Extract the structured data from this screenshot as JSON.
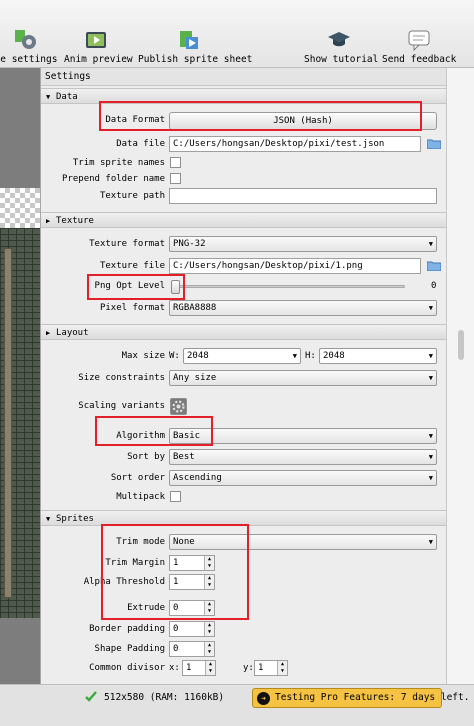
{
  "toolbar": {
    "items": [
      {
        "label": "le settings",
        "icon": "gear-icon"
      },
      {
        "label": "Anim preview",
        "icon": "film-icon"
      },
      {
        "label": "Publish sprite sheet",
        "icon": "publish-icon"
      },
      {
        "label": "Show tutorial",
        "icon": "graduation-cap-icon"
      },
      {
        "label": "Send feedback",
        "icon": "speech-bubble-icon"
      }
    ]
  },
  "panel": {
    "title": "Settings",
    "data": {
      "header": "Data",
      "data_format_label": "Data Format",
      "data_format_value": "JSON (Hash)",
      "data_file_label": "Data file",
      "data_file_value": "C:/Users/hongsan/Desktop/pixi/test.json",
      "trim_sprite_names_label": "Trim sprite names",
      "prepend_folder_name_label": "Prepend folder name",
      "texture_path_label": "Texture path",
      "texture_path_value": ""
    },
    "texture": {
      "header": "Texture",
      "texture_format_label": "Texture format",
      "texture_format_value": "PNG-32",
      "texture_file_label": "Texture file",
      "texture_file_value": "C:/Users/hongsan/Desktop/pixi/1.png",
      "png_opt_level_label": "Png Opt Level",
      "png_opt_level_value": "0",
      "png_opt_level_fraction": 0,
      "pixel_format_label": "Pixel format",
      "pixel_format_value": "RGBA8888"
    },
    "layout": {
      "header": "Layout",
      "max_size_label": "Max size",
      "w_label": "W:",
      "w_value": "2048",
      "h_label": "H:",
      "h_value": "2048",
      "size_constraints_label": "Size constraints",
      "size_constraints_value": "Any size",
      "scaling_variants_label": "Scaling variants",
      "algorithm_label": "Algorithm",
      "algorithm_value": "Basic",
      "sort_by_label": "Sort by",
      "sort_by_value": "Best",
      "sort_order_label": "Sort order",
      "sort_order_value": "Ascending",
      "multipack_label": "Multipack"
    },
    "sprites": {
      "header": "Sprites",
      "trim_mode_label": "Trim mode",
      "trim_mode_value": "None",
      "trim_margin_label": "Trim Margin",
      "trim_margin_value": "1",
      "alpha_threshold_label": "Alpha Threshold",
      "alpha_threshold_value": "1",
      "extrude_label": "Extrude",
      "extrude_value": "0",
      "border_padding_label": "Border padding",
      "border_padding_value": "0",
      "shape_padding_label": "Shape Padding",
      "shape_padding_value": "0",
      "common_divisor_label": "Common divisor",
      "x_label": "x:",
      "x_value": "1",
      "y_label": "y:",
      "y_value": "1"
    }
  },
  "status": {
    "size_text": "512x580 (RAM: 1160kB)",
    "promo_text": "Testing Pro Features: 7 days left."
  },
  "colors": {
    "highlight_box": "#e31f2a",
    "promo_bg": "#f5c242",
    "check_green": "#3aa93a"
  }
}
